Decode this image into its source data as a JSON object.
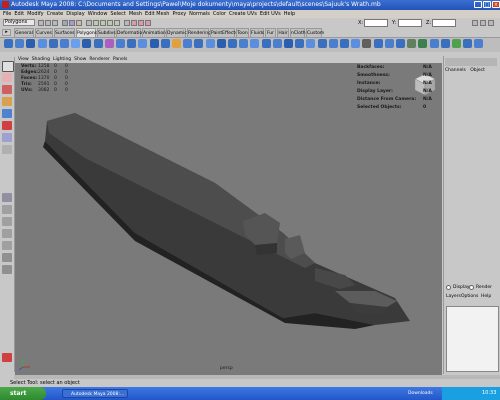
{
  "window": {
    "title": "Autodesk Maya 2008: C:\\Documents and Settings\\Pawel\\Moje dokumenty\\maya\\projects\\default\\scenes\\Sajuuk's Wrath.mb"
  },
  "menubar": [
    "File",
    "Edit",
    "Modify",
    "Create",
    "Display",
    "Window",
    "Select",
    "Mesh",
    "Edit Mesh",
    "Proxy",
    "Normals",
    "Color",
    "Create UVs",
    "Edit UVs",
    "Help"
  ],
  "statusline": {
    "mode": "Polygons",
    "field_labels": [
      "X:",
      "Y:",
      "Z:"
    ]
  },
  "shelf_tabs": [
    "General",
    "Curves",
    "Surfaces",
    "Polygons",
    "Subdivs",
    "Deformation",
    "Animation",
    "Dynamics",
    "Rendering",
    "PaintEffects",
    "Toon",
    "Fluids",
    "Fur",
    "Hair",
    "nCloth",
    "Custom"
  ],
  "shelf_active_tab": "Polygons",
  "viewport": {
    "menu": [
      "View",
      "Shading",
      "Lighting",
      "Show",
      "Renderer",
      "Panels"
    ],
    "hud_left": [
      {
        "label": "Verts:",
        "v1": "1258",
        "v2": "0",
        "v3": "0"
      },
      {
        "label": "Edges:",
        "v1": "2624",
        "v2": "0",
        "v3": "0"
      },
      {
        "label": "Faces:",
        "v1": "1370",
        "v2": "0",
        "v3": "0"
      },
      {
        "label": "Tris:",
        "v1": "2591",
        "v2": "0",
        "v3": "0"
      },
      {
        "label": "UVs:",
        "v1": "3082",
        "v2": "0",
        "v3": "0"
      }
    ],
    "hud_right": [
      {
        "label": "Backfaces:",
        "value": "N/A"
      },
      {
        "label": "Smoothness:",
        "value": "N/A"
      },
      {
        "label": "Instance:",
        "value": "N/A"
      },
      {
        "label": "Display Layer:",
        "value": "N/A"
      },
      {
        "label": "Distance From Camera:",
        "value": "N/A"
      },
      {
        "label": "Selected Objects:",
        "value": "0"
      }
    ],
    "camera": "persp"
  },
  "channel_box": {
    "tabs": [
      "Channels",
      "Object"
    ]
  },
  "layer_editor": {
    "tabs": [
      "Display",
      "Render"
    ],
    "menu": [
      "Layers",
      "Options",
      "Help"
    ]
  },
  "helpline": "Select Tool: select an object",
  "taskbar": {
    "start": "start",
    "items": [
      "Autodesk Maya 2008:...",
      "Downloads"
    ],
    "clock": "10:33"
  },
  "colors": {
    "titlebar": "#2453b8",
    "viewport_bg": "#7a7a7a",
    "model_dark": "#2c2c2c",
    "hud_green": "#1a1a1a"
  }
}
